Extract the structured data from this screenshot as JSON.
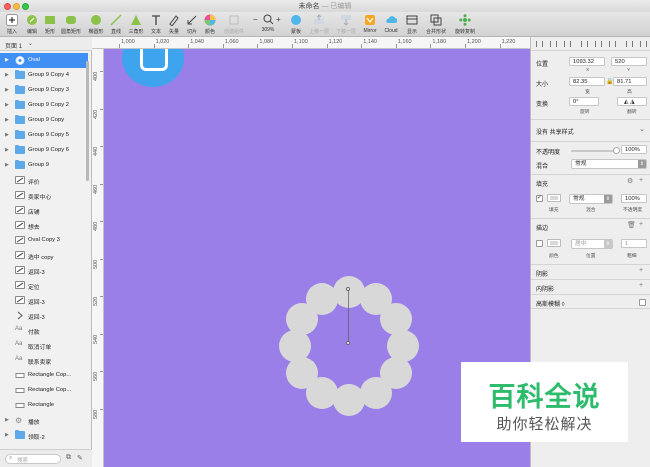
{
  "window": {
    "title": "未命名",
    "status": " — 已编辑"
  },
  "toolbar": {
    "items": [
      {
        "label": "插入",
        "icon": "plus-icon"
      },
      {
        "label": "编辑",
        "icon": "edit-icon"
      },
      {
        "label": "矩形",
        "icon": "rectangle-icon"
      },
      {
        "label": "圆角矩形",
        "icon": "rounded-rect-icon"
      },
      {
        "label": "椭圆形",
        "icon": "oval-icon"
      },
      {
        "label": "直线",
        "icon": "line-icon"
      },
      {
        "label": "三角形",
        "icon": "triangle-icon"
      },
      {
        "label": "文本",
        "icon": "text-icon"
      },
      {
        "label": "矢量",
        "icon": "vector-icon"
      },
      {
        "label": "切片",
        "icon": "slice-icon"
      },
      {
        "label": "颜色",
        "icon": "color-icon"
      },
      {
        "label": "创建组件",
        "icon": "component-icon"
      },
      {
        "label": "蒙板",
        "icon": "mask-icon"
      },
      {
        "label": "上移一层",
        "icon": "forward-icon"
      },
      {
        "label": "下移一层",
        "icon": "backward-icon"
      },
      {
        "label": "Mirror",
        "icon": "mirror-icon"
      },
      {
        "label": "Cloud",
        "icon": "cloud-icon"
      },
      {
        "label": "显示",
        "icon": "view-icon"
      },
      {
        "label": "合并形状",
        "icon": "combine-icon"
      },
      {
        "label": "旋转复制",
        "icon": "rotate-copy-icon"
      }
    ],
    "zoom": "309%",
    "zoom_minus": "−",
    "zoom_plus": "+"
  },
  "left_panel": {
    "page_label": "页面 1",
    "layers": [
      {
        "name": "Oval",
        "type": "shape",
        "selected": true
      },
      {
        "name": "Group 9 Copy 4",
        "type": "folder"
      },
      {
        "name": "Group 9 Copy 3",
        "type": "folder"
      },
      {
        "name": "Group 9 Copy 2",
        "type": "folder"
      },
      {
        "name": "Group 9 Copy",
        "type": "folder"
      },
      {
        "name": "Group 9 Copy 5",
        "type": "folder"
      },
      {
        "name": "Group 9 Copy 6",
        "type": "folder"
      },
      {
        "name": "Group 9",
        "type": "folder"
      },
      {
        "name": "评价",
        "type": "path"
      },
      {
        "name": "卖家中心",
        "type": "path"
      },
      {
        "name": "店铺",
        "type": "path"
      },
      {
        "name": "想去",
        "type": "path"
      },
      {
        "name": "Oval Copy 3",
        "type": "path"
      },
      {
        "name": "选中 copy",
        "type": "path"
      },
      {
        "name": "返回-3",
        "type": "path"
      },
      {
        "name": "定位",
        "type": "path"
      },
      {
        "name": "返回-3",
        "type": "path"
      },
      {
        "name": "返回-3",
        "type": "chevron"
      },
      {
        "name": "付款",
        "type": "text"
      },
      {
        "name": "取消订单",
        "type": "text"
      },
      {
        "name": "联系卖家",
        "type": "text"
      },
      {
        "name": "Rectangle Cop...",
        "type": "rect"
      },
      {
        "name": "Rectangle Cop...",
        "type": "rect"
      },
      {
        "name": "Rectangle",
        "type": "rect"
      },
      {
        "name": "播放",
        "type": "gear"
      },
      {
        "name": "领取-2",
        "type": "folder"
      }
    ],
    "search_placeholder": "搜索"
  },
  "rulers": {
    "top": [
      "1,000",
      "1,020",
      "1,040",
      "1,060",
      "1,080",
      "1,100",
      "1,120",
      "1,140",
      "1,160",
      "1,180",
      "1,200",
      "1,220"
    ],
    "left": [
      "400",
      "420",
      "440",
      "460",
      "480",
      "500",
      "520",
      "540",
      "560",
      "580"
    ]
  },
  "inspector": {
    "position_label": "位置",
    "x": "1093.32",
    "y": "520",
    "x_sub": "X",
    "y_sub": "Y",
    "size_label": "大小",
    "width": "82.35",
    "height": "81.71",
    "width_sub": "宽",
    "height_sub": "高",
    "lock_icon": "lock-icon",
    "transform_label": "变换",
    "rotation": "0°",
    "rotation_sub": "旋转",
    "flip_sub": "翻转",
    "shared_style": "没有 共享样式",
    "opacity_label": "不透明度",
    "opacity": "100%",
    "opacity_level": 1.0,
    "blend_label": "混合",
    "blend_value": "常规",
    "fill_section": "填充",
    "fill_blend": "常规",
    "fill_opacity": "100%",
    "fill_sub_fill": "填充",
    "fill_sub_blend": "混合",
    "fill_sub_opacity": "不透明度",
    "fill_color": "#d8d8d8",
    "border_section": "描边",
    "border_position": "居中",
    "border_width": "1",
    "border_sub_color": "颜色",
    "border_sub_position": "位置",
    "border_sub_width": "粗细",
    "shadow_section": "阴影",
    "inner_shadow_section": "内阴影",
    "blur_section": "高斯模糊 ◊"
  },
  "canvas": {
    "background": "#9b7fe8",
    "circle_color": "#d8d8d8",
    "top_shape_color": "#3fa4ee"
  },
  "watermark": {
    "main": "百科全说",
    "sub": "助你轻松解决"
  }
}
